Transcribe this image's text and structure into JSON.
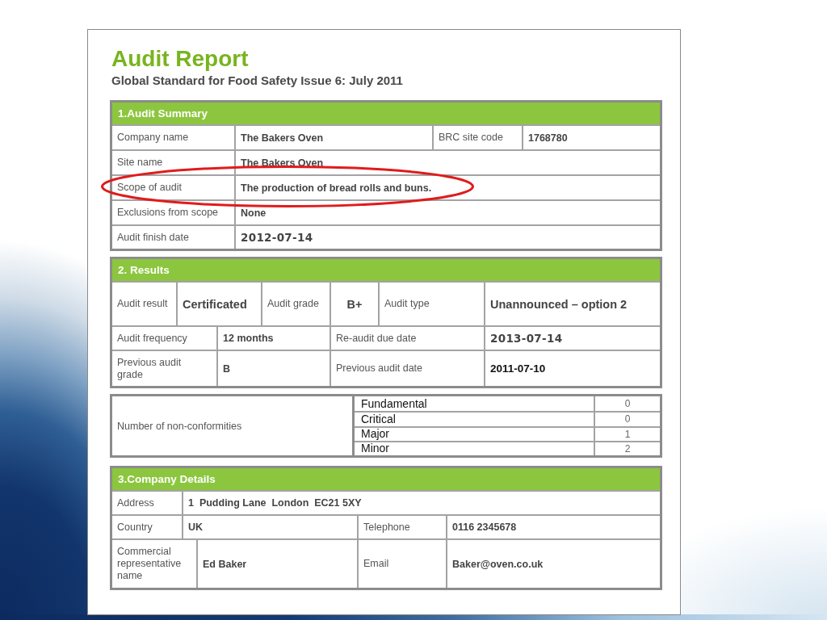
{
  "title": "Audit Report",
  "subtitle": "Global Standard for Food Safety Issue 6: July 2011",
  "blocks": [
    {
      "kind": "section",
      "title": "1.Audit Summary",
      "rows": [
        {
          "circled": false,
          "cells": [
            {
              "kind": "label",
              "text": "Company name"
            },
            {
              "kind": "value",
              "text": "The Bakers Oven"
            },
            {
              "kind": "label",
              "text": "BRC site code"
            },
            {
              "kind": "value",
              "text": "1768780"
            }
          ]
        },
        {
          "circled": false,
          "cells": [
            {
              "kind": "label",
              "text": "Site name"
            },
            {
              "kind": "value",
              "text": "The Bakers Oven",
              "colspan": 3
            }
          ]
        },
        {
          "circled": true,
          "cells": [
            {
              "kind": "label",
              "text": "Scope of audit"
            },
            {
              "kind": "value",
              "text": "The production of bread rolls and buns.",
              "colspan": 3
            }
          ]
        },
        {
          "circled": false,
          "cells": [
            {
              "kind": "label",
              "text": "Exclusions from scope"
            },
            {
              "kind": "value",
              "text": "None",
              "colspan": 3
            }
          ]
        },
        {
          "circled": false,
          "cells": [
            {
              "kind": "label",
              "text": "Audit finish date"
            },
            {
              "kind": "date",
              "text": "2012-07-14",
              "colspan": 3
            }
          ]
        }
      ]
    },
    {
      "kind": "section",
      "title": "2. Results",
      "rows": [
        {
          "circled": false,
          "cells": [
            {
              "kind": "label",
              "text": "Audit result"
            },
            {
              "kind": "large",
              "text": "Certificated",
              "colspan": 2
            },
            {
              "kind": "label",
              "text": "Audit grade"
            },
            {
              "kind": "grade",
              "text": "B+"
            },
            {
              "kind": "label",
              "text": "Audit type"
            },
            {
              "kind": "large",
              "text": "Unannounced – option 2"
            }
          ]
        },
        {
          "circled": false,
          "cells": [
            {
              "kind": "label",
              "text": "Audit frequency",
              "colspan": 2
            },
            {
              "kind": "value",
              "text": "12 months",
              "colspan": 2
            },
            {
              "kind": "label",
              "text": "Re-audit due date",
              "colspan": 2
            },
            {
              "kind": "date",
              "text": "2013-07-14"
            }
          ]
        },
        {
          "circled": false,
          "cells": [
            {
              "kind": "label",
              "text": "Previous audit grade",
              "colspan": 2
            },
            {
              "kind": "value",
              "text": "B",
              "colspan": 2
            },
            {
              "kind": "label",
              "text": "Previous audit date",
              "colspan": 2
            },
            {
              "kind": "strong",
              "text": "2011-07-10"
            }
          ]
        }
      ]
    },
    {
      "kind": "tally",
      "label": "Number of non-conformities",
      "items": [
        {
          "category": "Fundamental",
          "count": "0"
        },
        {
          "category": "Critical",
          "count": "0"
        },
        {
          "category": "Major",
          "count": "1"
        },
        {
          "category": "Minor",
          "count": "2"
        }
      ]
    },
    {
      "kind": "section",
      "title": "3.Company Details",
      "rows": [
        {
          "circled": false,
          "cells": [
            {
              "kind": "label",
              "text": "Address"
            },
            {
              "kind": "value",
              "text": "1  Pudding Lane  London  EC21 5XY",
              "colspan": 4
            }
          ]
        },
        {
          "circled": false,
          "cells": [
            {
              "kind": "label",
              "text": "Country"
            },
            {
              "kind": "value",
              "text": "UK",
              "colspan": 2
            },
            {
              "kind": "label",
              "text": "Telephone"
            },
            {
              "kind": "value",
              "text": "0116 2345678"
            }
          ]
        },
        {
          "circled": false,
          "cells": [
            {
              "kind": "label",
              "text": "Commercial representative name",
              "colspan": 2
            },
            {
              "kind": "value",
              "text": "Ed Baker"
            },
            {
              "kind": "label",
              "text": "Email"
            },
            {
              "kind": "value",
              "text": "Baker@oven.co.uk"
            }
          ]
        }
      ]
    }
  ]
}
